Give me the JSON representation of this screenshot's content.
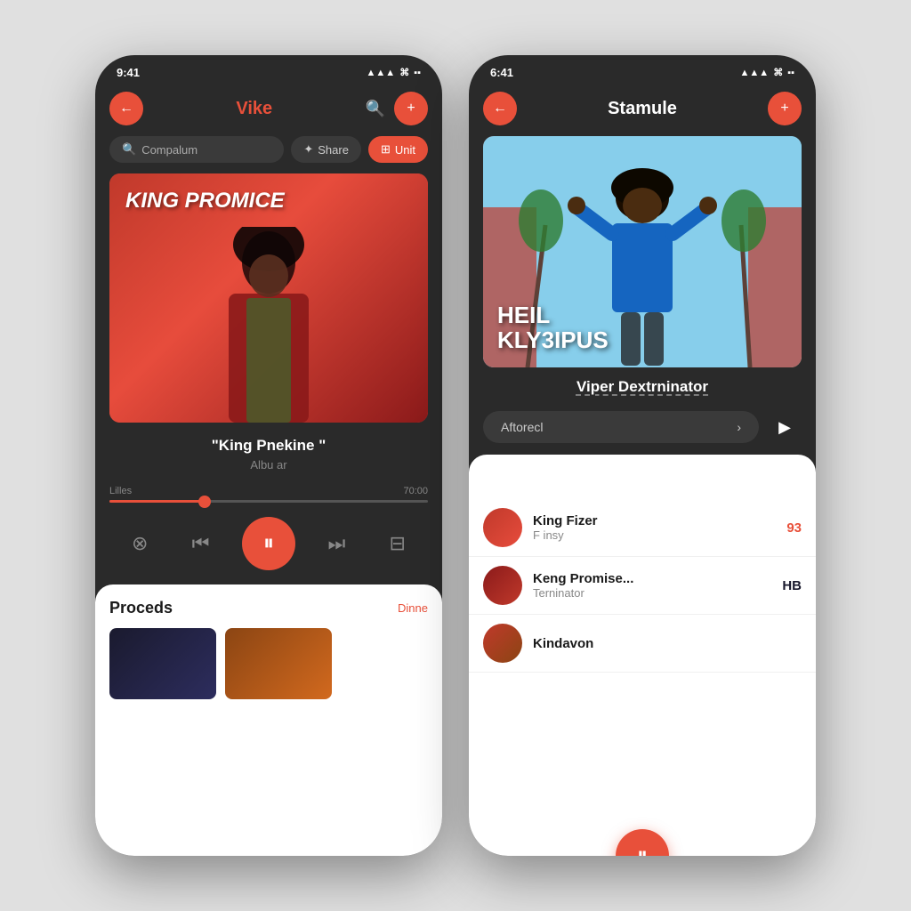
{
  "phone1": {
    "status_time": "9:41",
    "header": {
      "title": "Vike",
      "search_placeholder": "Compalum"
    },
    "toolbar": {
      "share_label": "Share",
      "unit_label": "Unit"
    },
    "album": {
      "title_line1": "KING PROMICE",
      "track_name": "\"King Pnekine \"",
      "album_name": "Albu ar",
      "progress_start": "Lilles",
      "progress_end": "70:00"
    },
    "bottom_panel": {
      "title": "Proceds",
      "link": "Dinne"
    }
  },
  "phone2": {
    "status_time": "6:41",
    "header": {
      "title": "Stamule"
    },
    "album": {
      "title_line1": "HEIL",
      "title_line2": "KLY3IPUS",
      "artist": "Viper  Dextrninator"
    },
    "action": {
      "pill_label": "Aftorecl",
      "pill_arrow": "›"
    },
    "list": {
      "items": [
        {
          "title": "King Fizer",
          "subtitle": "F insy",
          "badge": "93",
          "badge_type": "orange"
        },
        {
          "title": "Keng Promise...",
          "subtitle": "Terninator",
          "badge": "HB",
          "badge_type": "dark"
        },
        {
          "title": "Kindavon",
          "subtitle": "",
          "badge": "",
          "badge_type": ""
        }
      ]
    }
  }
}
